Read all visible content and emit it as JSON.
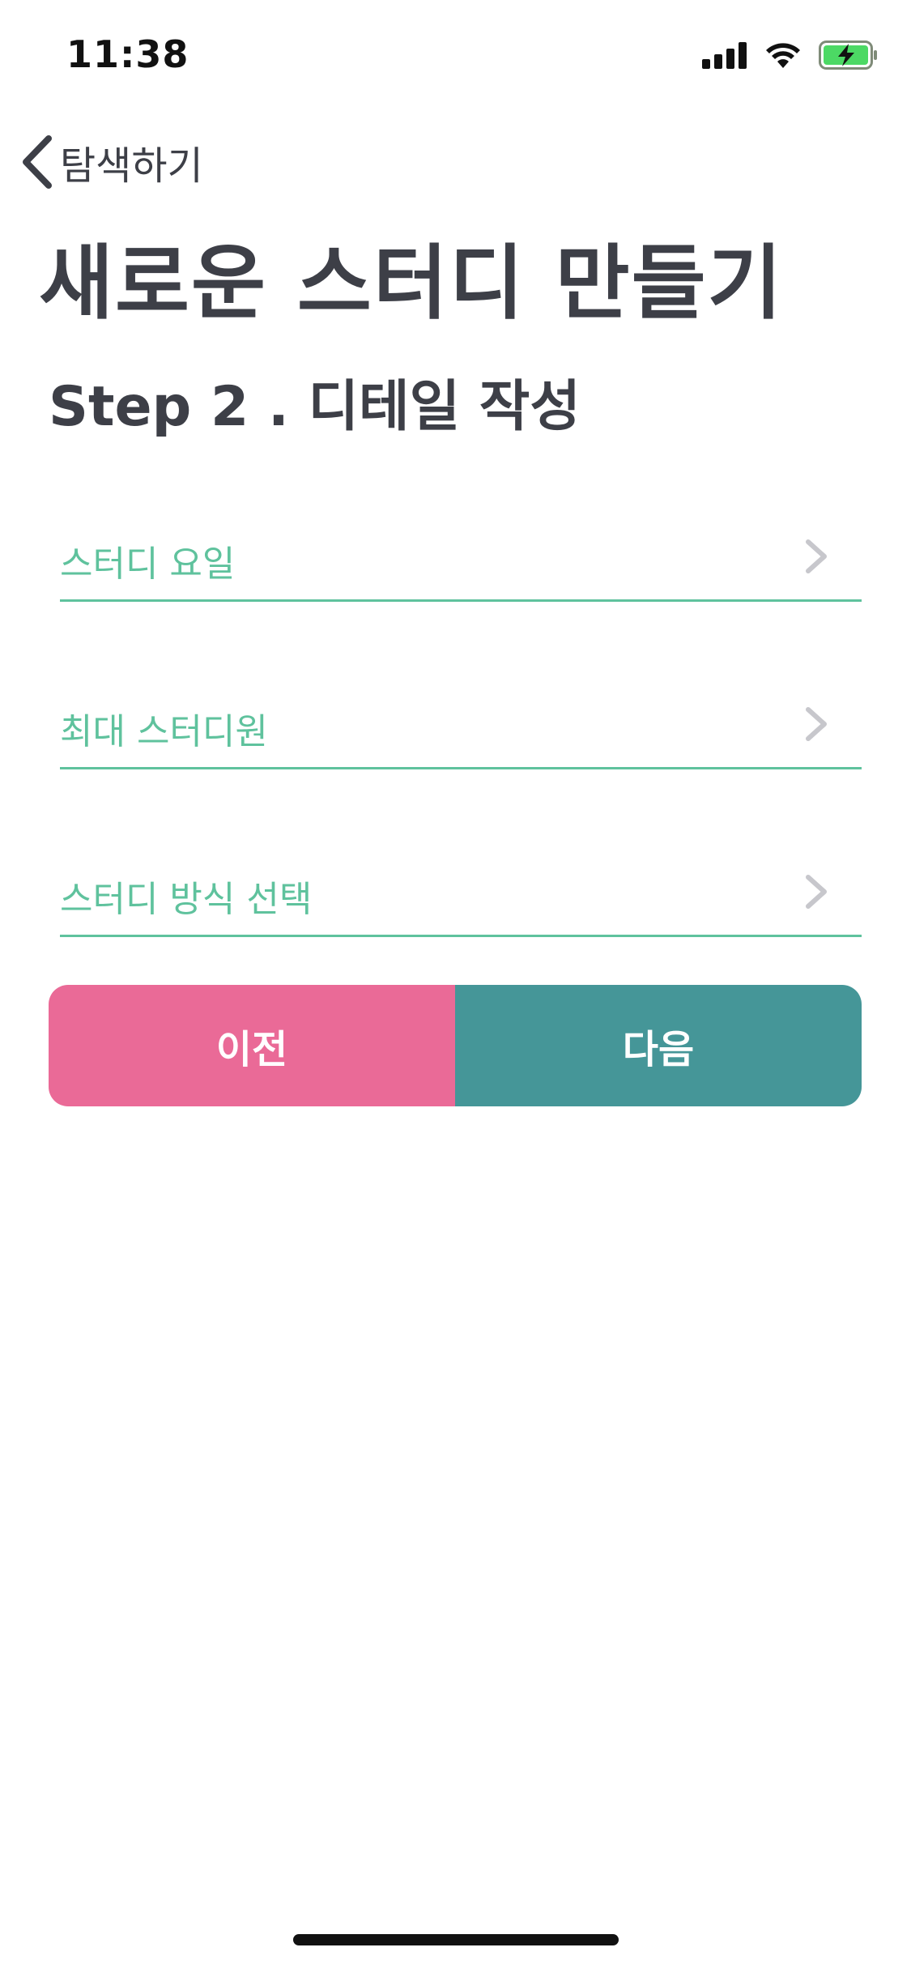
{
  "status_bar": {
    "time": "11:38"
  },
  "nav": {
    "back_label": "탐색하기"
  },
  "header": {
    "title": "새로운 스터디 만들기",
    "step": "Step 2 . 디테일 작성"
  },
  "form": {
    "rows": [
      {
        "label": "스터디 요일"
      },
      {
        "label": "최대 스터디원"
      },
      {
        "label": "스터디 방식 선택"
      }
    ]
  },
  "buttons": {
    "prev": "이전",
    "next": "다음"
  },
  "colors": {
    "accent_green": "#5fc29d",
    "prev_pink": "#ea6a97",
    "next_teal": "#459698",
    "text_dark": "#3d3f47",
    "battery_green": "#4cd964"
  }
}
